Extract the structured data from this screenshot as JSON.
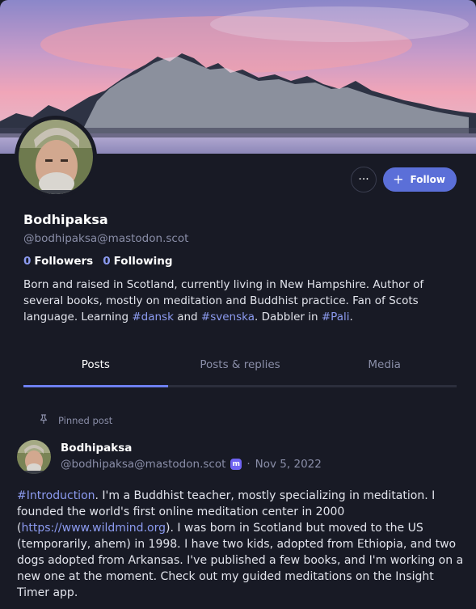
{
  "profile": {
    "display_name": "Bodhipaksa",
    "handle": "@bodhipaksa@mastodon.scot",
    "followers_count": "0",
    "followers_label": "Followers",
    "following_count": "0",
    "following_label": "Following",
    "bio": {
      "part1": "Born and raised in Scotland, currently living in New Hampshire. Author of several books, mostly on meditation and Buddhist practice. Fan of Scots language. Learning ",
      "tag1": "#dansk",
      "part2": " and ",
      "tag2": "#svenska",
      "part3": ". Dabbler in ",
      "tag3": "#Pali",
      "part4": "."
    }
  },
  "actions": {
    "more_label": "···",
    "follow_label": "Follow",
    "follow_icon": "+"
  },
  "tabs": [
    {
      "label": "Posts",
      "active": true
    },
    {
      "label": "Posts & replies",
      "active": false
    },
    {
      "label": "Media",
      "active": false
    }
  ],
  "post": {
    "pinned_label": "Pinned post",
    "author_name": "Bodhipaksa",
    "author_handle": "@bodhipaksa@mastodon.scot",
    "separator": "·",
    "date": "Nov 5, 2022",
    "text": {
      "tag": "#Introduction",
      "part1": ". I'm a Buddhist teacher, mostly specializing in meditation. I founded the world's first online meditation center in 2000 (",
      "link": "https://www.wildmind.org",
      "part2": "). I was born in Scotland but moved to the US (temporarily, ahem) in 1998. I have two kids, adopted from Ethiopia, and two dogs adopted from Arkansas. I've published a few books, and I'm working on a new one at the moment. Check out my guided meditations on the Insight Timer app."
    }
  },
  "colors": {
    "background": "#181a25",
    "accent": "#5b6fd8",
    "link": "#8c9bf0",
    "muted": "#8a8ea8"
  },
  "icons": [
    "more-icon",
    "plus-icon",
    "pin-icon",
    "mastodon-bot-icon"
  ]
}
